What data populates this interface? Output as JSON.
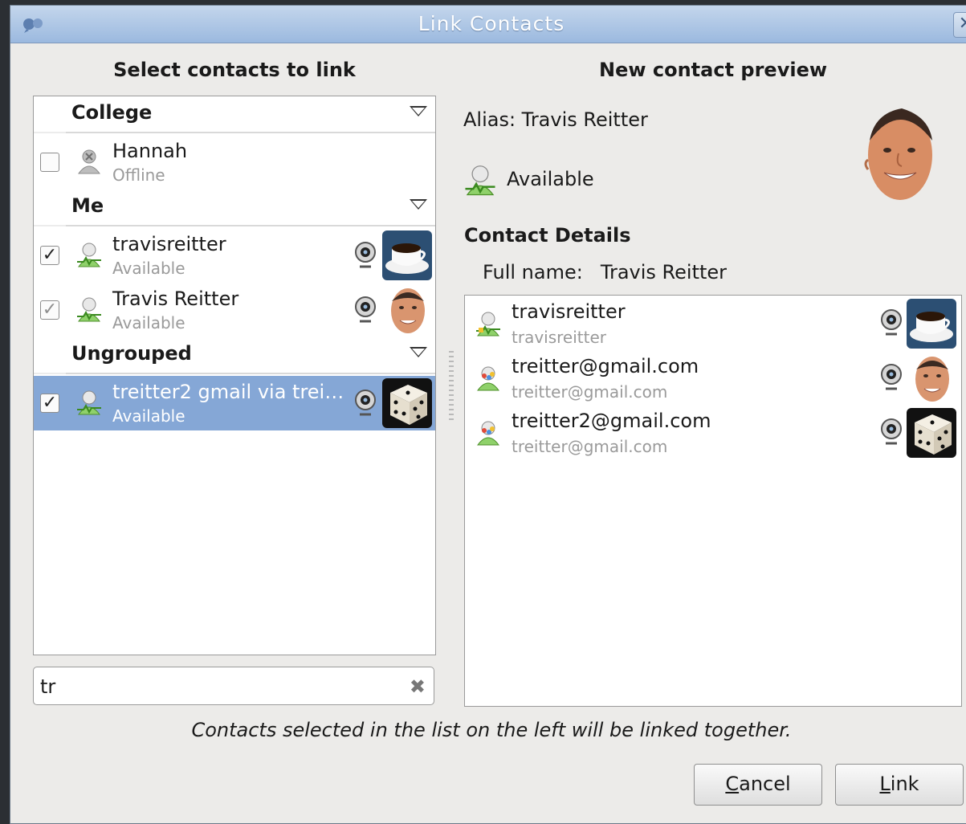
{
  "window": {
    "title": "Link Contacts"
  },
  "left": {
    "heading": "Select contacts to link",
    "groups": [
      {
        "name": "College"
      },
      {
        "name": "Me"
      },
      {
        "name": "Ungrouped"
      }
    ],
    "contacts": [
      {
        "name": "Hannah",
        "status": "Offline",
        "checked": false
      },
      {
        "name": "travisreitter",
        "status": "Available",
        "checked": true
      },
      {
        "name": "Travis Reitter",
        "status": "Available",
        "checked": true
      },
      {
        "name": "treitter2 gmail via trei…",
        "status": "Available",
        "checked": true,
        "selected": true
      }
    ],
    "search_value": "tr"
  },
  "right": {
    "heading": "New contact preview",
    "alias_label": "Alias: Travis Reitter",
    "presence": "Available",
    "details_heading": "Contact Details",
    "fullname_label": "Full name:",
    "fullname_value": "Travis Reitter",
    "personas": [
      {
        "name": "travisreitter",
        "sub": "travisreitter"
      },
      {
        "name": "treitter@gmail.com",
        "sub": "treitter@gmail.com"
      },
      {
        "name": "treitter2@gmail.com",
        "sub": "treitter@gmail.com"
      }
    ]
  },
  "note": "Contacts selected in the list on the left will be linked together.",
  "buttons": {
    "cancel_rest": "ancel",
    "cancel_mnemonic": "C",
    "link_rest": "ink",
    "link_mnemonic": "L"
  },
  "colors": {
    "selection": "#85a7d6",
    "titlebar": "#9bb9df",
    "available": "#58b52e"
  }
}
